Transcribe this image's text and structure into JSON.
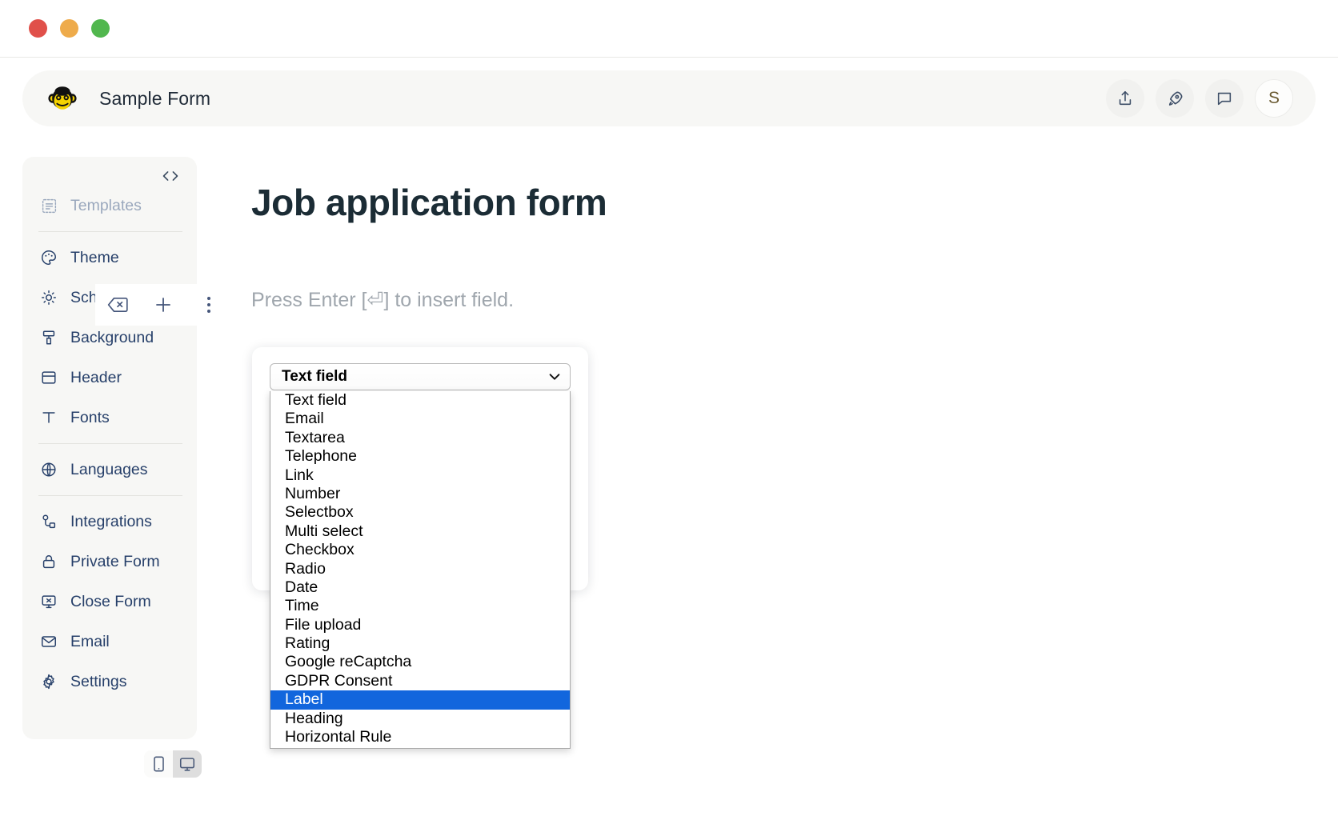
{
  "window": {
    "traffic_lights": [
      "close",
      "minimize",
      "zoom"
    ]
  },
  "header": {
    "logo": "monkey-face-logo",
    "title": "Sample Form",
    "actions": [
      {
        "name": "share-button",
        "icon": "upload-share-icon"
      },
      {
        "name": "publish-button",
        "icon": "rocket-icon"
      },
      {
        "name": "comments-button",
        "icon": "speech-bubble-icon"
      }
    ],
    "avatar_initial": "S"
  },
  "sidebar": {
    "code_toggle": "code-brackets-icon",
    "groups": [
      {
        "items": [
          {
            "label": "Templates",
            "icon": "templates-icon",
            "muted": true
          }
        ]
      },
      {
        "items": [
          {
            "label": "Theme",
            "icon": "palette-icon",
            "muted": false
          },
          {
            "label": "Scheme",
            "icon": "sun-moon-icon",
            "muted": false
          },
          {
            "label": "Background",
            "icon": "paint-roller-icon",
            "muted": false
          },
          {
            "label": "Header",
            "icon": "header-layout-icon",
            "muted": false
          },
          {
            "label": "Fonts",
            "icon": "text-t-icon",
            "muted": false
          }
        ]
      },
      {
        "items": [
          {
            "label": "Languages",
            "icon": "globe-icon",
            "muted": false
          }
        ]
      },
      {
        "items": [
          {
            "label": "Integrations",
            "icon": "plug-nodes-icon",
            "muted": false
          },
          {
            "label": "Private Form",
            "icon": "lock-icon",
            "muted": false
          },
          {
            "label": "Close Form",
            "icon": "monitor-x-icon",
            "muted": false
          },
          {
            "label": "Email",
            "icon": "envelope-icon",
            "muted": false
          },
          {
            "label": "Settings",
            "icon": "gear-icon",
            "muted": false
          }
        ]
      }
    ]
  },
  "device_toggle": {
    "options": [
      {
        "name": "mobile",
        "icon": "mobile-phone-icon",
        "active": false
      },
      {
        "name": "desktop",
        "icon": "desktop-monitor-icon",
        "active": true
      }
    ]
  },
  "canvas": {
    "form_title": "Job application form",
    "insert_hint": "Press Enter [⏎] to insert field."
  },
  "block_toolbar": {
    "buttons": [
      {
        "name": "delete-field-button",
        "icon": "backspace-delete-icon"
      },
      {
        "name": "add-field-button",
        "icon": "plus-icon"
      },
      {
        "name": "more-options-button",
        "icon": "vertical-dots-icon"
      }
    ]
  },
  "field_type_select": {
    "value": "Text field",
    "chevron": "chevron-down-icon",
    "expanded": true,
    "highlighted": "Label",
    "options": [
      "Text field",
      "Email",
      "Textarea",
      "Telephone",
      "Link",
      "Number",
      "Selectbox",
      "Multi select",
      "Checkbox",
      "Radio",
      "Date",
      "Time",
      "File upload",
      "Rating",
      "Google reCaptcha",
      "GDPR Consent",
      "Label",
      "Heading",
      "Horizontal Rule"
    ]
  },
  "colors": {
    "accent": "#27406a",
    "highlight": "#1266dd",
    "panel": "#f7f7f5",
    "logo_yellow": "#f5d300",
    "traffic_red": "#e0504a",
    "traffic_yellow": "#eeab4b",
    "traffic_green": "#51b74e"
  }
}
